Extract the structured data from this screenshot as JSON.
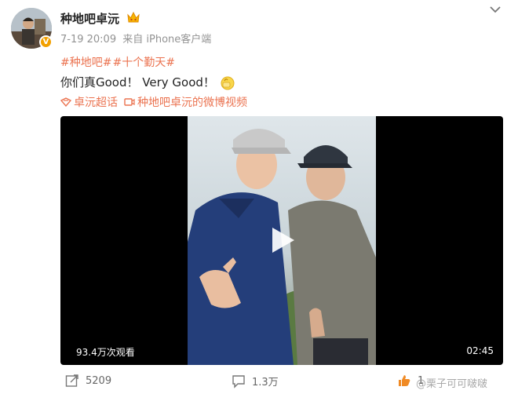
{
  "user": {
    "name": "种地吧卓沅",
    "verified_badge": "V",
    "avatar": "avatar"
  },
  "post": {
    "time": "7-19 20:09",
    "source": "来自 iPhone客户端",
    "tags": [
      "#种地吧#",
      "#十个勤天#"
    ],
    "text": "你们真Good！ Very Good！",
    "links": [
      {
        "icon": "supertopic-icon",
        "label": "卓沅超话"
      },
      {
        "icon": "video-link-icon",
        "label": "种地吧卓沅的微博视频"
      }
    ]
  },
  "video": {
    "views": "93.4万次观看",
    "duration": "02:45"
  },
  "actions": {
    "forward": "5209",
    "comment": "1.3万",
    "like": "1"
  },
  "watermark": "@栗子可可啵啵",
  "colors": {
    "link": "#eb7350",
    "meta": "#939393",
    "badge": "#f2a000"
  }
}
